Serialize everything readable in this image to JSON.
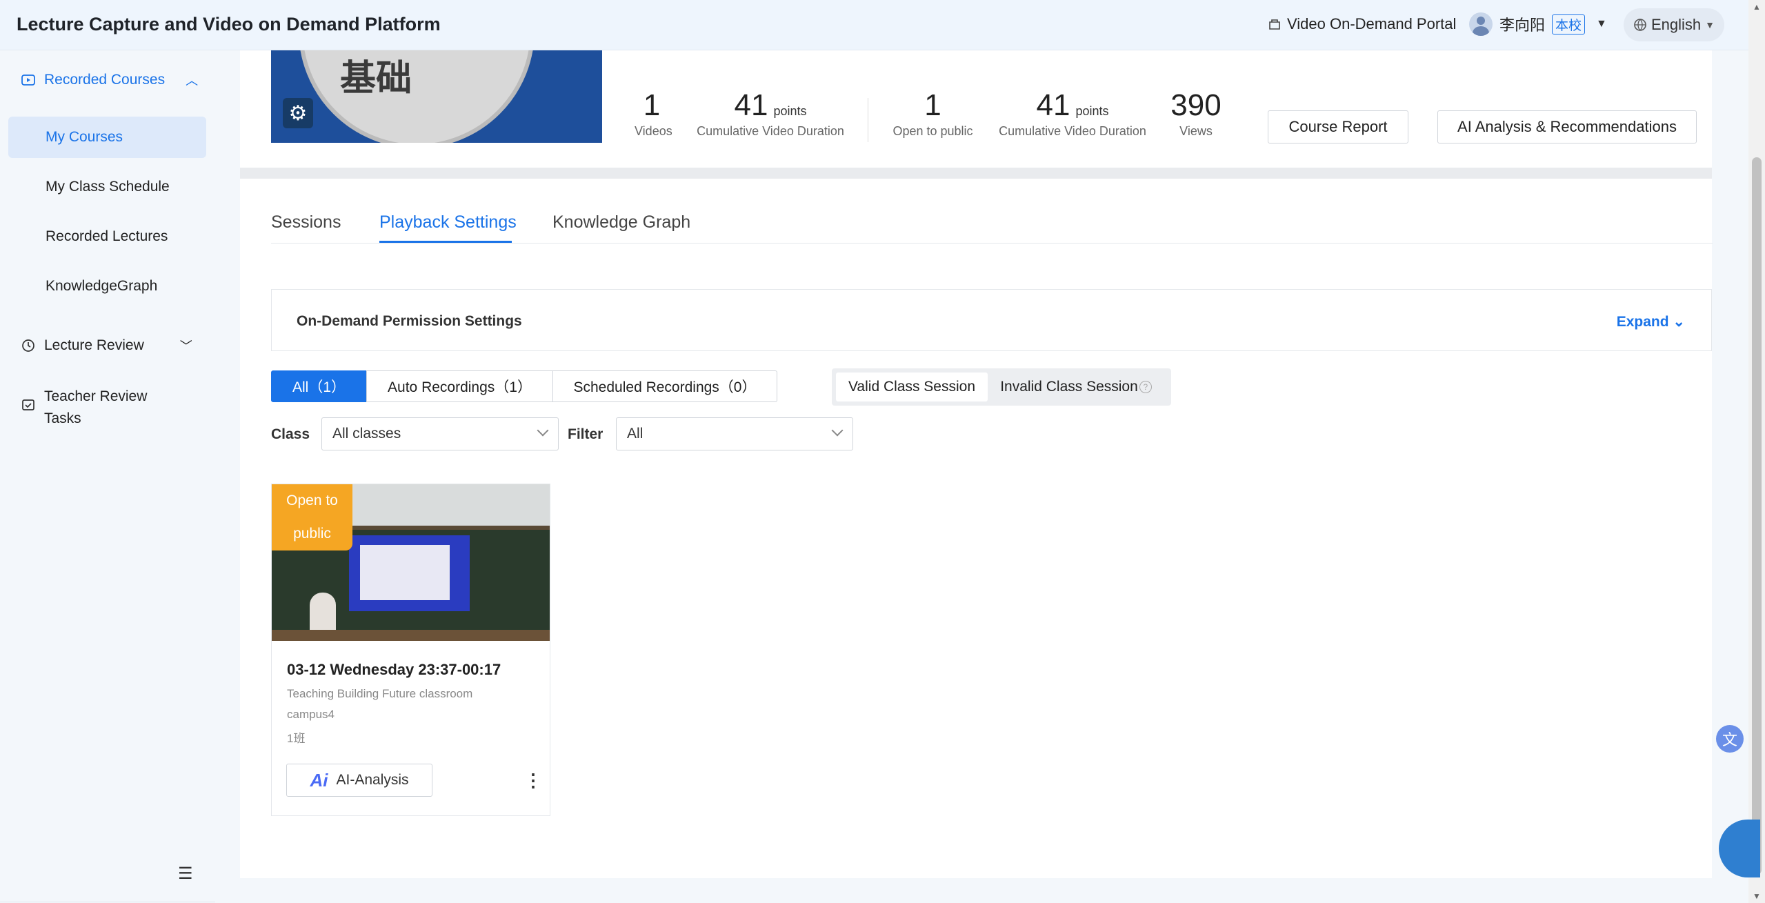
{
  "header": {
    "app_title": "Lecture Capture and Video on Demand Platform",
    "portal_label": "Video On-Demand Portal",
    "user_name": "李向阳",
    "user_badge": "本校",
    "language": "English"
  },
  "sidebar": {
    "recorded_courses": "Recorded Courses",
    "items": [
      "My Courses",
      "My Class Schedule",
      "Recorded Lectures",
      "KnowledgeGraph"
    ],
    "lecture_review": "Lecture Review",
    "teacher_review": "Teacher Review Tasks"
  },
  "course": {
    "cover_text": "基础",
    "stats": [
      {
        "num": "1",
        "unit": "",
        "label": "Videos"
      },
      {
        "num": "41",
        "unit": "points",
        "label": "Cumulative Video Duration"
      },
      {
        "num": "1",
        "unit": "",
        "label": "Open to public"
      },
      {
        "num": "41",
        "unit": "points",
        "label": "Cumulative Video Duration"
      },
      {
        "num": "390",
        "unit": "",
        "label": "Views"
      }
    ],
    "course_report": "Course Report",
    "ai_analysis": "AI Analysis & Recommendations"
  },
  "tabs": [
    "Sessions",
    "Playback Settings",
    "Knowledge Graph"
  ],
  "permission": {
    "title": "On-Demand Permission Settings",
    "expand": "Expand"
  },
  "segments": [
    "All（1）",
    "Auto Recordings（1）",
    "Scheduled Recordings（0）"
  ],
  "validity": [
    "Valid Class Session",
    "Invalid Class Session"
  ],
  "filters": {
    "class_label": "Class",
    "class_value": "All classes",
    "filter_label": "Filter",
    "filter_value": "All"
  },
  "recording": {
    "badge": "Open to public",
    "title": "03-12 Wednesday 23:37-00:17",
    "location": "Teaching Building Future classroom",
    "campus": "campus4",
    "class_name": "1班",
    "ai_button": "AI-Analysis",
    "ai_logo": "Ai"
  }
}
